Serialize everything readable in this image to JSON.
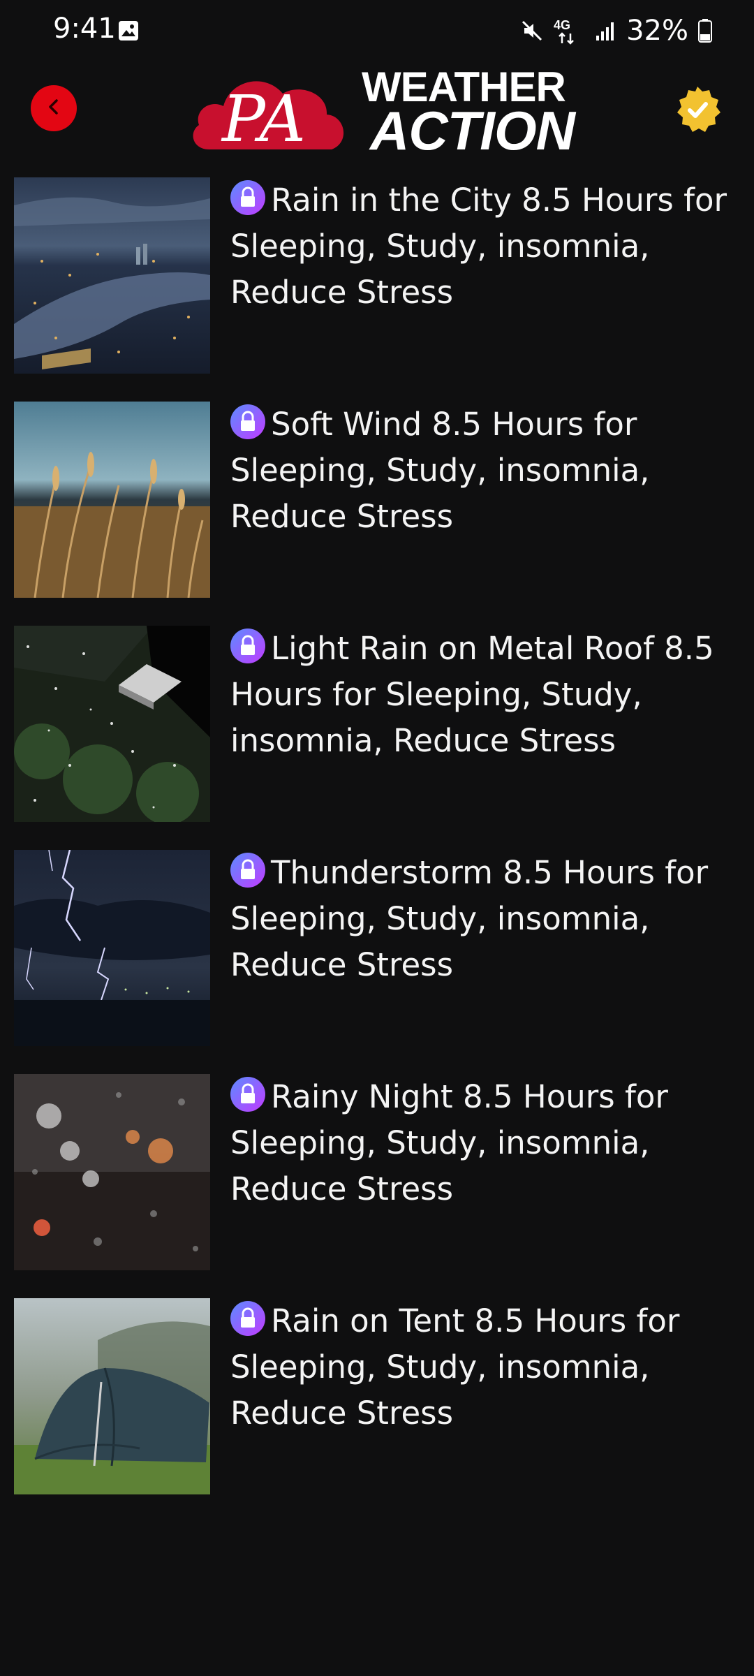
{
  "status_bar": {
    "time": "9:41",
    "battery_percent": "32%",
    "network_label": "4G"
  },
  "header": {
    "logo_monogram": "PA",
    "logo_line1": "WEATHER",
    "logo_line2": "ACTION",
    "back_icon": "chevron-left-icon",
    "badge_icon": "verified-badge-icon"
  },
  "colors": {
    "background": "#0f0f10",
    "brand_red": "#e30613",
    "badge_gold": "#f2c230",
    "lock_gradient_start": "#5b8cff",
    "lock_gradient_end": "#c23bff"
  },
  "tracks": [
    {
      "title": "Rain in the City 8.5 Hours for Sleeping, Study, insomnia, Reduce Stress",
      "locked": true
    },
    {
      "title": "Soft Wind 8.5 Hours for Sleeping, Study, insomnia, Reduce Stress",
      "locked": true
    },
    {
      "title": "Light Rain on Metal Roof 8.5 Hours for Sleeping, Study, insomnia, Reduce Stress",
      "locked": true
    },
    {
      "title": "Thunderstorm 8.5 Hours for Sleeping, Study, insomnia, Reduce Stress",
      "locked": true
    },
    {
      "title": "Rainy Night 8.5 Hours for Sleeping, Study, insomnia, Reduce Stress",
      "locked": true
    },
    {
      "title": "Rain on Tent 8.5 Hours for Sleeping, Study, insomnia, Reduce Stress",
      "locked": true
    }
  ]
}
